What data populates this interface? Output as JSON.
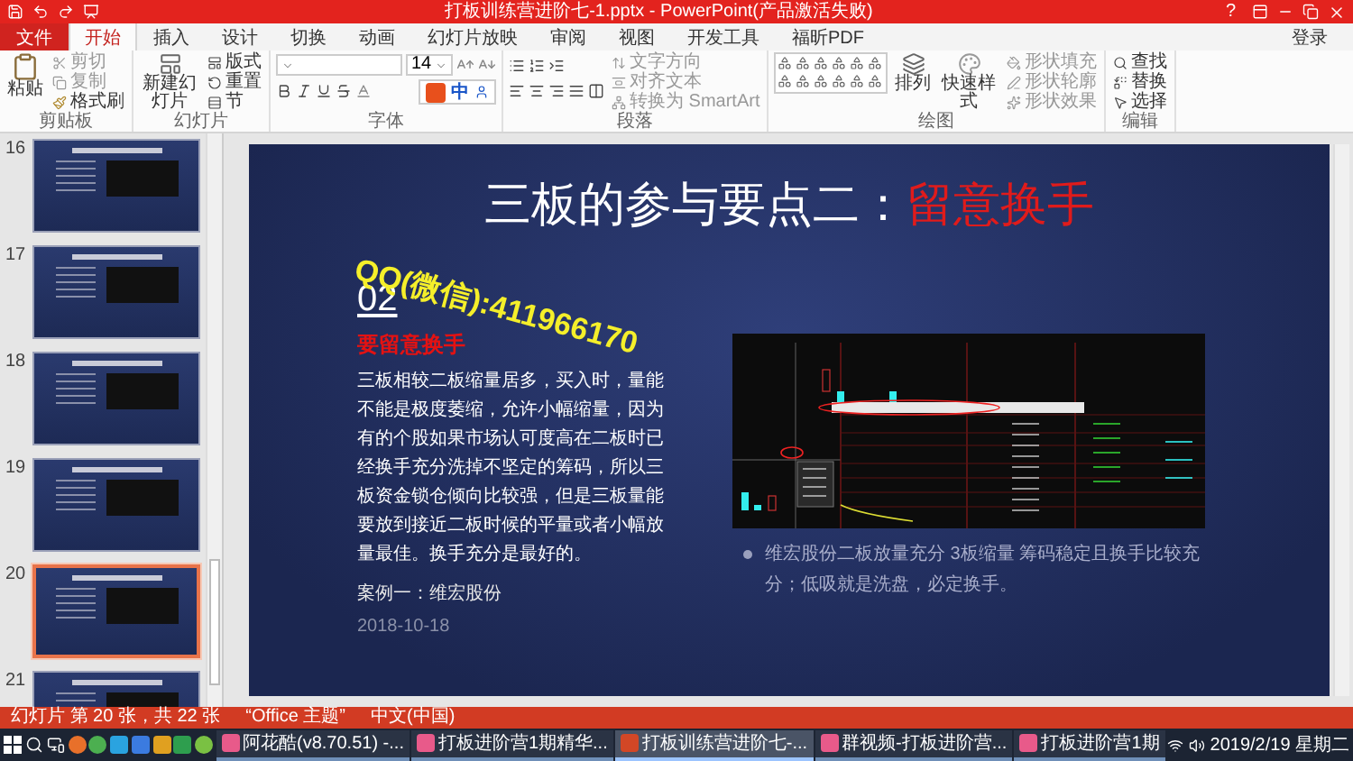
{
  "window": {
    "title": "打板训练营进阶七-1.pptx - PowerPoint(产品激活失败)",
    "help": "?"
  },
  "ribbon": {
    "tabs": [
      {
        "label": "文件",
        "kind": "file",
        "selected": false
      },
      {
        "label": "开始",
        "kind": "tab",
        "selected": true
      },
      {
        "label": "插入",
        "kind": "tab",
        "selected": false
      },
      {
        "label": "设计",
        "kind": "tab",
        "selected": false
      },
      {
        "label": "切换",
        "kind": "tab",
        "selected": false
      },
      {
        "label": "动画",
        "kind": "tab",
        "selected": false
      },
      {
        "label": "幻灯片放映",
        "kind": "tab",
        "selected": false
      },
      {
        "label": "审阅",
        "kind": "tab",
        "selected": false
      },
      {
        "label": "视图",
        "kind": "tab",
        "selected": false
      },
      {
        "label": "开发工具",
        "kind": "tab",
        "selected": false
      },
      {
        "label": "福昕PDF",
        "kind": "tab",
        "selected": false
      }
    ],
    "account": "登录",
    "clipboard": {
      "paste": "粘贴",
      "cut": "剪切",
      "copy": "复制",
      "format_painter": "格式刷",
      "label": "剪贴板"
    },
    "slides_group": {
      "new_slide": "新建幻灯片",
      "layout": "版式",
      "reset": "重置",
      "section": "节",
      "label": "幻灯片"
    },
    "font": {
      "size": "14",
      "label": "字体"
    },
    "paragraph": {
      "text_direction": "文字方向",
      "align_text": "对齐文本",
      "smartart": "转换为 SmartArt",
      "label": "段落"
    },
    "drawing": {
      "arrange": "排列",
      "quick_styles": "快速样式",
      "shape_fill": "形状填充",
      "shape_outline": "形状轮廓",
      "shape_effects": "形状效果",
      "label": "绘图"
    },
    "editing": {
      "find": "查找",
      "replace": "替换",
      "select": "选择",
      "label": "编辑"
    }
  },
  "ime_toolbar": {
    "mode": "中"
  },
  "thumbnails": [
    {
      "number": "16",
      "selected": false
    },
    {
      "number": "17",
      "selected": false
    },
    {
      "number": "18",
      "selected": false
    },
    {
      "number": "19",
      "selected": false
    },
    {
      "number": "20",
      "selected": true
    },
    {
      "number": "21",
      "selected": false
    }
  ],
  "slide": {
    "title": {
      "main": "三板的参与要点二：",
      "highlight": "留意换手"
    },
    "contact": "QQ(微信):411966170",
    "section_number": "02",
    "heading": "要留意换手",
    "body": "三板相较二板缩量居多，买入时，量能不能是极度萎缩，允许小幅缩量，因为有的个股如果市场认可度高在二板时已经换手充分洗掉不坚定的筹码，所以三板资金锁仓倾向比较强，但是三板量能要放到接近二板时候的平量或者小幅放量最佳。换手充分是最好的。",
    "case_title": "案例一：维宏股份",
    "case_date": "2018-10-18",
    "bullet": "维宏股份二板放量充分 3板缩量 筹码稳定且换手比较充分；低吸就是洗盘，必定换手。"
  },
  "status_bar": {
    "slide_info": "幻灯片 第 20 张，共 22 张",
    "theme": "“Office 主题”",
    "language": "中文(中国)"
  },
  "taskbar": {
    "windows": [
      {
        "label": "阿花酷(v8.70.51) -...",
        "selected": false
      },
      {
        "label": "打板进阶营1期精华...",
        "selected": false
      },
      {
        "label": "打板训练营进阶七-...",
        "selected": true
      },
      {
        "label": "群视频-打板进阶营...",
        "selected": false
      },
      {
        "label": "打板进阶营1期",
        "selected": false
      }
    ],
    "date": "2019/2/19 星期二"
  }
}
